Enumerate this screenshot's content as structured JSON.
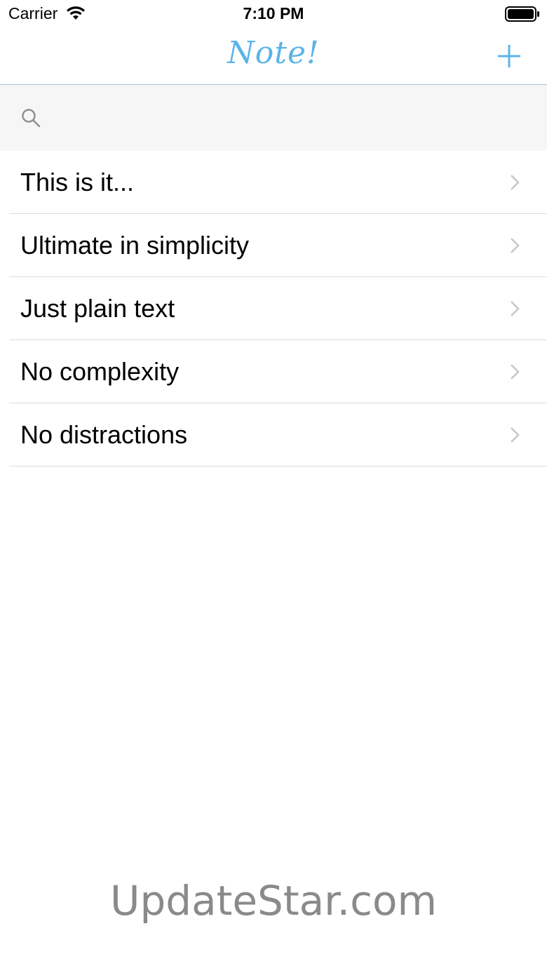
{
  "status_bar": {
    "carrier": "Carrier",
    "time": "7:10 PM"
  },
  "nav": {
    "title": "Note!",
    "add_icon": "plus-icon"
  },
  "search": {
    "placeholder": "",
    "value": "",
    "icon": "search-icon"
  },
  "notes": [
    {
      "title": "This is it..."
    },
    {
      "title": "Ultimate in simplicity"
    },
    {
      "title": "Just plain text"
    },
    {
      "title": "No complexity"
    },
    {
      "title": "No distractions"
    }
  ],
  "watermark": "UpdateStar.com",
  "colors": {
    "accent": "#5ab4e8",
    "separator": "#dcdcdf",
    "search_background": "#f6f6f7",
    "chevron": "#c7c7cc"
  }
}
